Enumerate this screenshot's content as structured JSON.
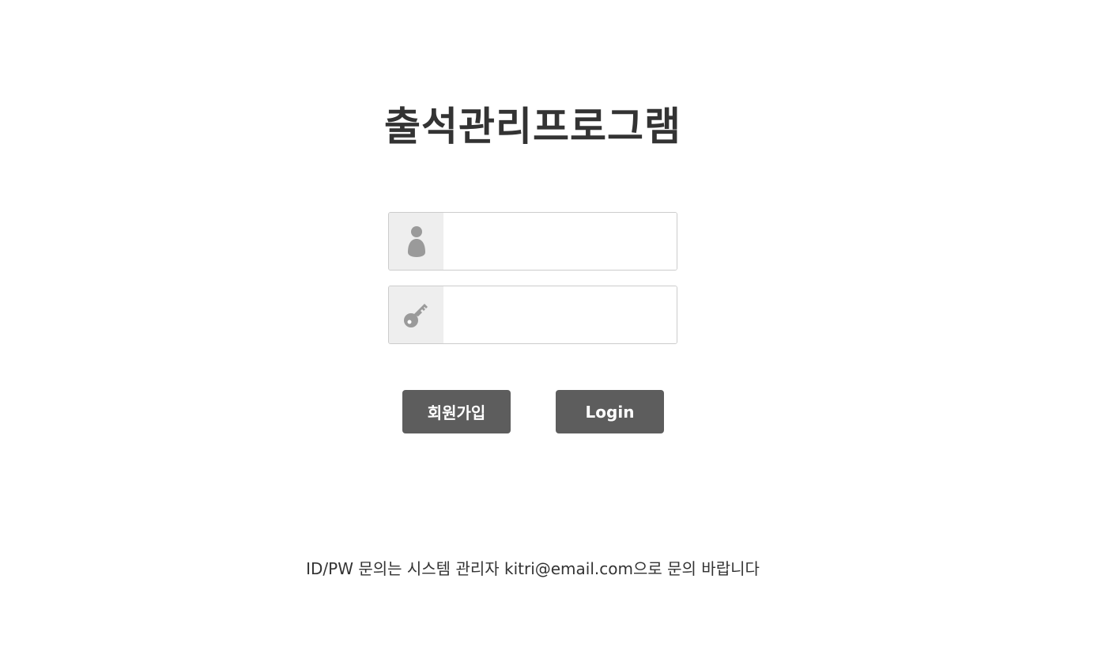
{
  "title": "출석관리프로그램",
  "login_form": {
    "id_field": {
      "value": "",
      "placeholder": "",
      "icon": "user-icon"
    },
    "pw_field": {
      "value": "",
      "placeholder": "",
      "icon": "key-icon"
    }
  },
  "buttons": {
    "signup_label": "회원가입",
    "login_label": "Login"
  },
  "footer": {
    "contact_text": "ID/PW 문의는 시스템 관리자 kitri@email.com으로 문의 바랍니다"
  },
  "colors": {
    "button_bg": "#5d5d5d",
    "icon_color": "#9a9a9a",
    "addon_bg": "#eeeeee",
    "text": "#333333"
  }
}
